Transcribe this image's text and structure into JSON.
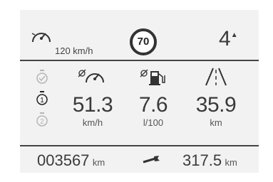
{
  "cruise": {
    "speed": "120 km/h",
    "icon": "speedometer-icon"
  },
  "speed_limit_sign": "70",
  "gear": {
    "value": "4",
    "shift_up": "▲"
  },
  "trip_selector": {
    "icons": [
      "check-timer-icon",
      "trip-1-timer-icon",
      "trip-2-timer-icon"
    ]
  },
  "avg_speed": {
    "value": "51.3",
    "unit": "km/h",
    "icon": "average-speed-icon"
  },
  "avg_consumption": {
    "value": "7.6",
    "unit": "l/100",
    "icon": "average-fuel-icon"
  },
  "range": {
    "value": "35.9",
    "unit": "km",
    "icon": "road-icon"
  },
  "odometer": {
    "value": "003567",
    "unit": "km"
  },
  "service": {
    "value": "317.5",
    "unit": "km",
    "icon": "wrench-icon"
  }
}
